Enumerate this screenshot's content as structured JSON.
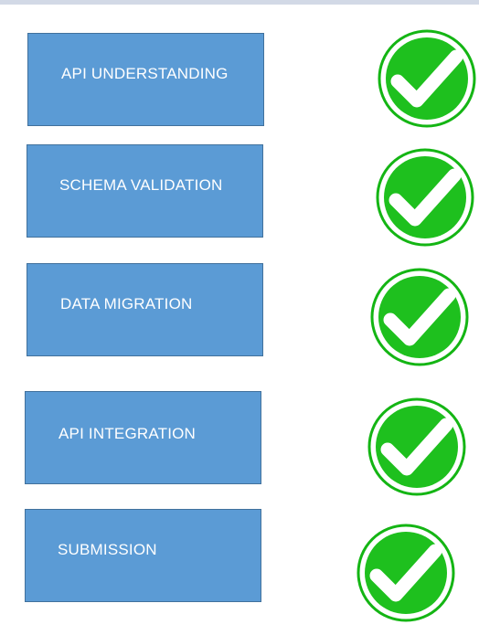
{
  "steps": [
    {
      "label": "API UNDERSTANDING",
      "status_icon": "check-circle-icon",
      "status_color": "#1ec01e"
    },
    {
      "label": "SCHEMA VALIDATION",
      "status_icon": "check-circle-icon",
      "status_color": "#1ec01e"
    },
    {
      "label": "DATA MIGRATION",
      "status_icon": "check-circle-icon",
      "status_color": "#1ec01e"
    },
    {
      "label": "API INTEGRATION",
      "status_icon": "check-circle-icon",
      "status_color": "#1ec01e"
    },
    {
      "label": "SUBMISSION",
      "status_icon": "check-circle-icon",
      "status_color": "#1ec01e"
    }
  ],
  "colors": {
    "box_fill": "#5b9bd5",
    "box_border": "#41719c",
    "check_fill": "#1ec01e",
    "check_ring": "#0e9e0e"
  }
}
